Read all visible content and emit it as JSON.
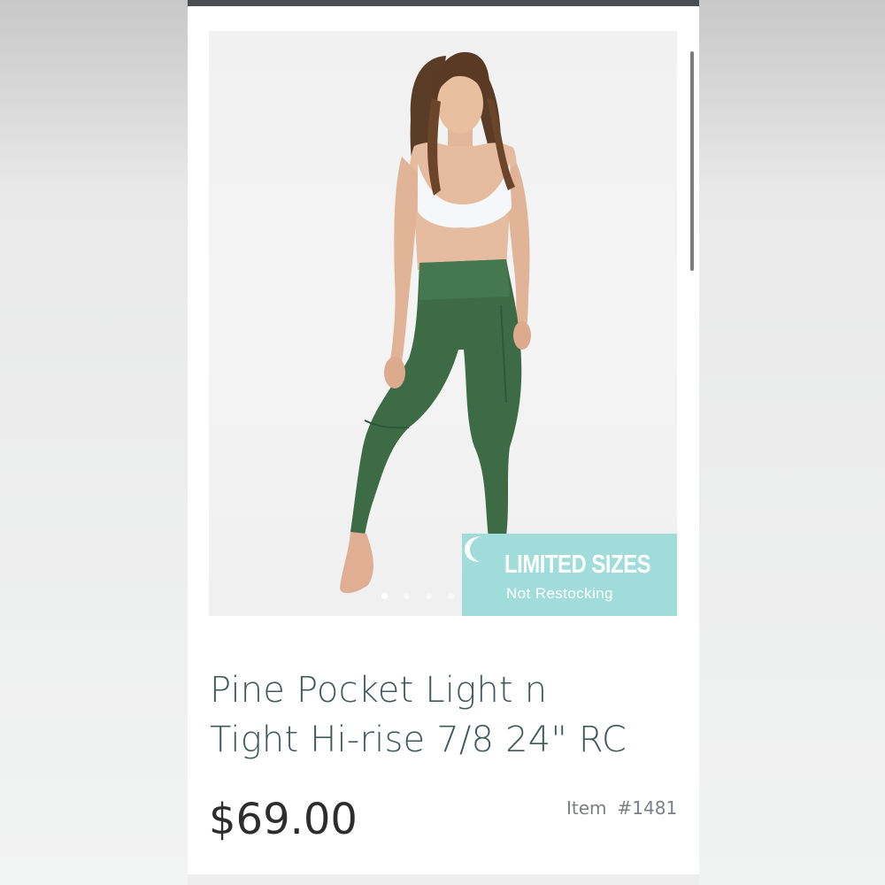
{
  "product": {
    "image_alt": "Woman wearing green high-rise pocket leggings and white sports bra",
    "badge": {
      "title": "LIMITED SIZES",
      "subtitle": "Not Restocking",
      "color": "#9fdcda"
    },
    "carousel": {
      "total_slides": 6,
      "active_slide": 1
    },
    "title_line1": "Pine Pocket Light n",
    "title_line2": "Tight Hi-rise 7/8 24\" RC",
    "price": "$69.00",
    "item_label": "Item",
    "item_number": "#1481"
  },
  "colors": {
    "title_text": "#3f5a5b",
    "price_text": "#2d2d2d",
    "legging_green": "#3d6b45"
  },
  "icons": {
    "badge_icon": "crescent-moon-icon"
  }
}
